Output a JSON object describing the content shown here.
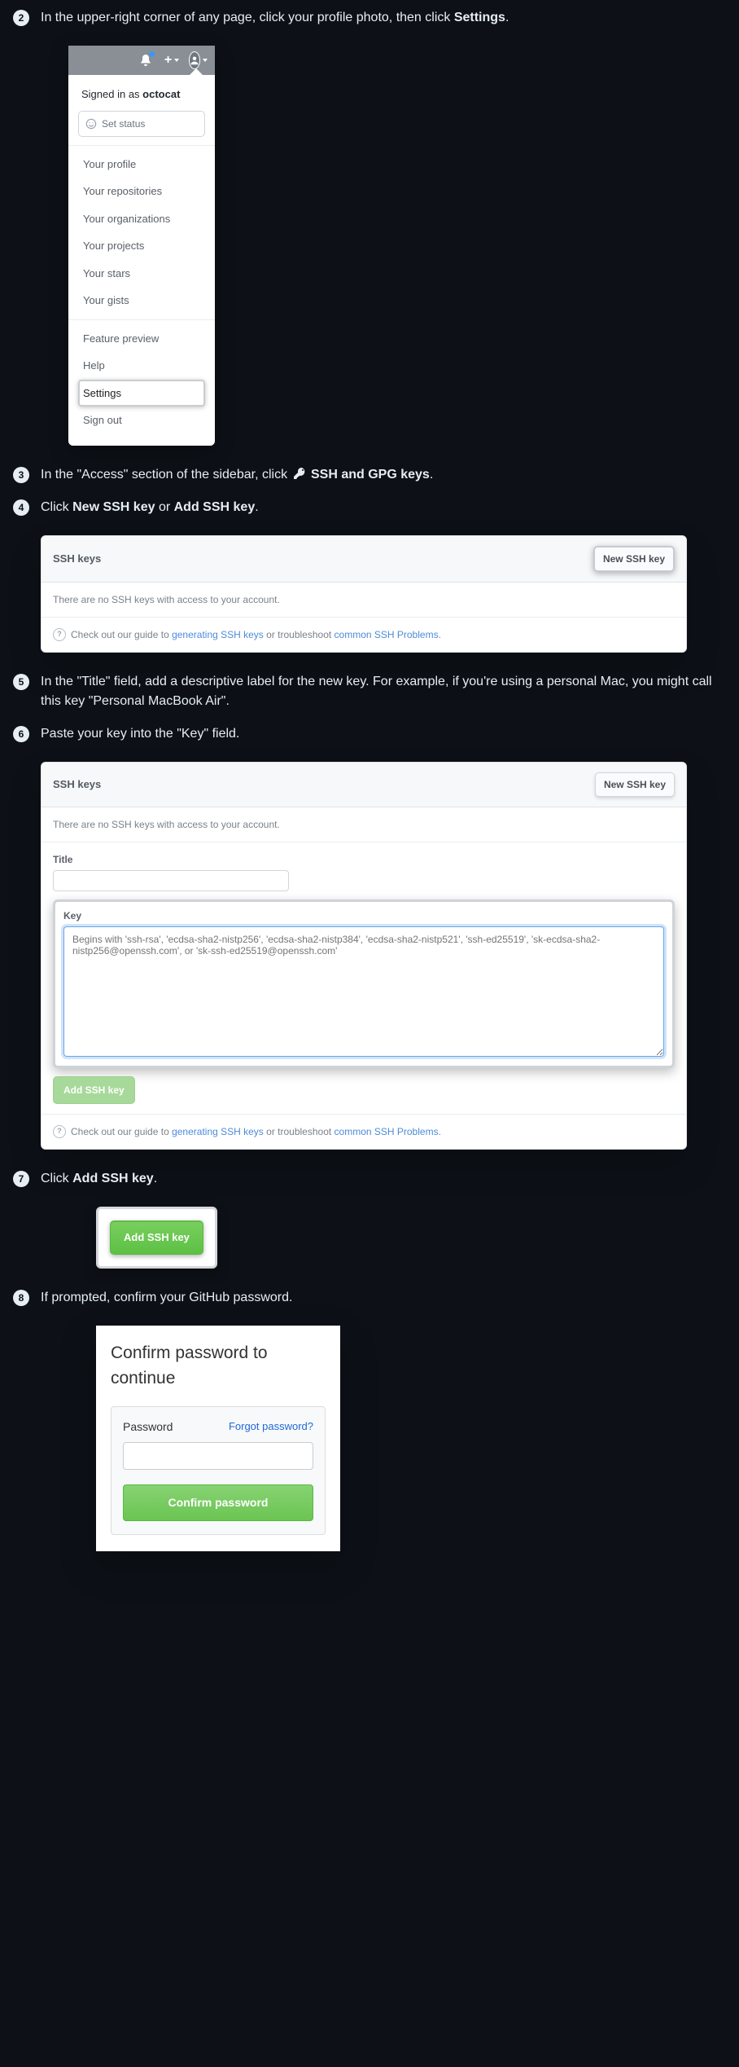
{
  "steps": {
    "s2": {
      "num": "2",
      "text_before": "In the upper-right corner of any page, click your profile photo, then click ",
      "strong": "Settings",
      "text_after": "."
    },
    "s3": {
      "num": "3",
      "text_before": "In the \"Access\" section of the sidebar, click ",
      "strong": "SSH and GPG keys",
      "text_after": "."
    },
    "s4": {
      "num": "4",
      "text_before": "Click ",
      "strong1": "New SSH key",
      "mid": " or ",
      "strong2": "Add SSH key",
      "text_after": "."
    },
    "s5": {
      "num": "5",
      "text": "In the \"Title\" field, add a descriptive label for the new key. For example, if you're using a personal Mac, you might call this key \"Personal MacBook Air\"."
    },
    "s6": {
      "num": "6",
      "text": "Paste your key into the \"Key\" field."
    },
    "s7": {
      "num": "7",
      "text_before": "Click ",
      "strong": "Add SSH key",
      "text_after": "."
    },
    "s8": {
      "num": "8",
      "text": "If prompted, confirm your GitHub password."
    }
  },
  "profileMenu": {
    "signedInPrefix": "Signed in as ",
    "username": "octocat",
    "setStatus": "Set status",
    "group1": [
      "Your profile",
      "Your repositories",
      "Your organizations",
      "Your projects",
      "Your stars",
      "Your gists"
    ],
    "group2": [
      "Feature preview",
      "Help"
    ],
    "settings": "Settings",
    "signOut": "Sign out"
  },
  "sshPanel": {
    "title": "SSH keys",
    "newBtn": "New SSH key",
    "empty": "There are no SSH keys with access to your account.",
    "guideBefore": "Check out our guide to ",
    "guideLink1": "generating SSH keys",
    "guideMid": " or troubleshoot ",
    "guideLink2": "common SSH Problems",
    "guideAfter": "."
  },
  "sshForm": {
    "titleLabel": "Title",
    "keyLabel": "Key",
    "keyPlaceholder": "Begins with 'ssh-rsa', 'ecdsa-sha2-nistp256', 'ecdsa-sha2-nistp384', 'ecdsa-sha2-nistp521', 'ssh-ed25519', 'sk-ecdsa-sha2-nistp256@openssh.com', or 'sk-ssh-ed25519@openssh.com'",
    "addBtn": "Add SSH key"
  },
  "addBtnFigure": {
    "label": "Add SSH key"
  },
  "confirmPw": {
    "heading": "Confirm password to continue",
    "passwordLabel": "Password",
    "forgot": "Forgot password?",
    "confirmBtn": "Confirm password"
  }
}
